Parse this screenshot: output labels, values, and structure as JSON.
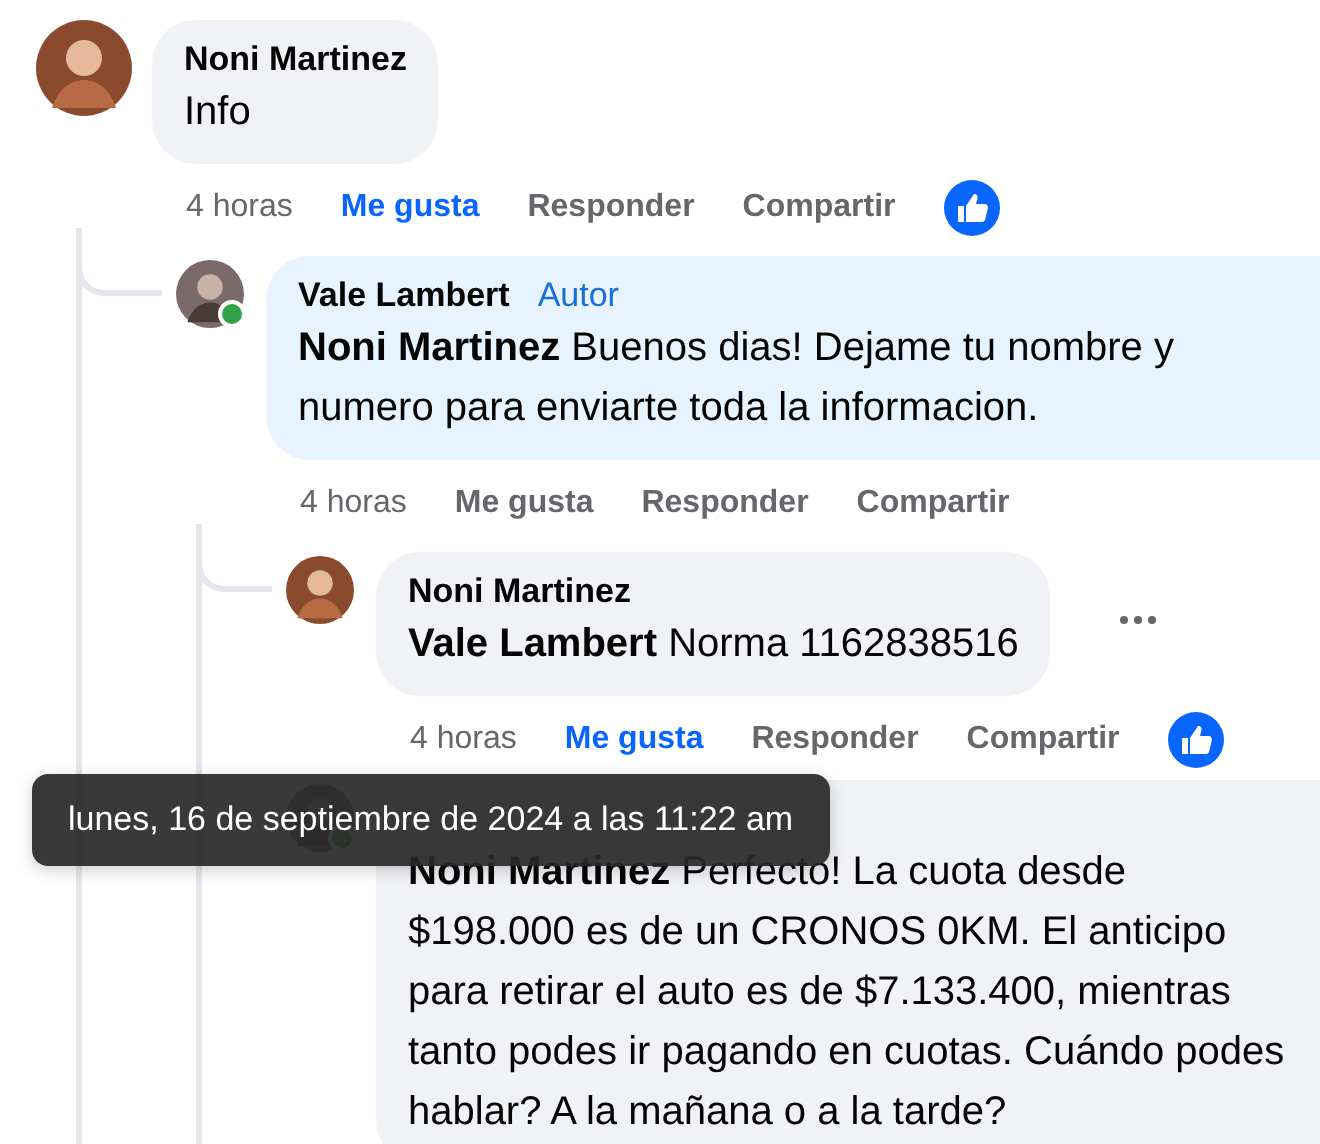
{
  "comments": [
    {
      "author": "Noni Martinez",
      "text": "Info",
      "time": "4 horas",
      "actions": [
        "Me gusta",
        "Responder",
        "Compartir"
      ],
      "liked": true,
      "replies": [
        {
          "author": "Vale Lambert",
          "author_badge": "Autor",
          "online": true,
          "text": "**Noni Martinez** Buenos dias! Dejame tu nombre y numero para enviarte toda la informacion.",
          "time": "4 horas",
          "actions": [
            "Me gusta",
            "Responder",
            "Compartir"
          ],
          "liked": false,
          "replies": [
            {
              "author": "Noni Martinez",
              "text": "**Vale Lambert** Norma 1162838516",
              "time": "4 horas",
              "actions": [
                "Me gusta",
                "Responder",
                "Compartir"
              ],
              "liked": true,
              "more_menu": true
            },
            {
              "online": true,
              "text": "**Noni Martinez** Perfecto! La cuota desde $198.000 es de un CRONOS 0KM. El anticipo para retirar el auto es de $7.133.400, mientras tanto podes ir pagando en cuotas. Cuándo podes hablar? A la mañana o a la tarde?"
            }
          ]
        }
      ]
    }
  ],
  "tooltip": {
    "text": "lunes, 16 de septiembre de 2024 a las 11:22 am"
  }
}
